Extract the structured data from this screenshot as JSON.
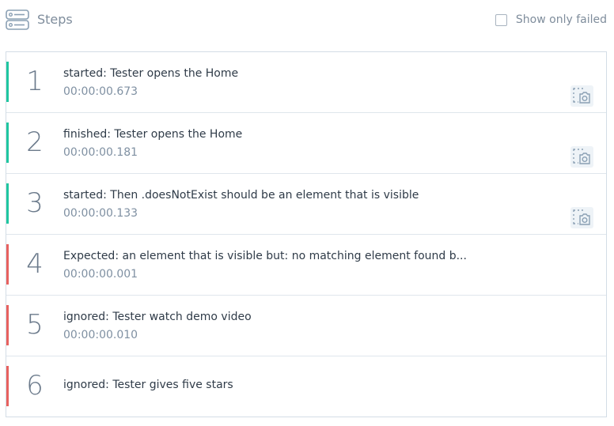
{
  "header": {
    "title": "Steps",
    "filter_label": "Show only failed",
    "filter_checked": false
  },
  "colors": {
    "passed": "#1fc6a0",
    "failed": "#e8615f",
    "icon": "#8aa0b4"
  },
  "steps": [
    {
      "number": "1",
      "title": "started: Tester opens the Home",
      "time": "00:00:00.673",
      "status": "passed",
      "has_screenshot": true
    },
    {
      "number": "2",
      "title": "finished: Tester opens the Home",
      "time": "00:00:00.181",
      "status": "passed",
      "has_screenshot": true
    },
    {
      "number": "3",
      "title": "started: Then .doesNotExist should be an element that is visible",
      "time": "00:00:00.133",
      "status": "passed",
      "has_screenshot": true
    },
    {
      "number": "4",
      "title": "Expected: an element that is visible but: no matching element found b...",
      "time": "00:00:00.001",
      "status": "failed",
      "has_screenshot": false
    },
    {
      "number": "5",
      "title": "ignored: Tester watch demo video",
      "time": "00:00:00.010",
      "status": "failed",
      "has_screenshot": false
    },
    {
      "number": "6",
      "title": "ignored: Tester gives five stars",
      "time": "",
      "status": "failed",
      "has_screenshot": false
    }
  ]
}
